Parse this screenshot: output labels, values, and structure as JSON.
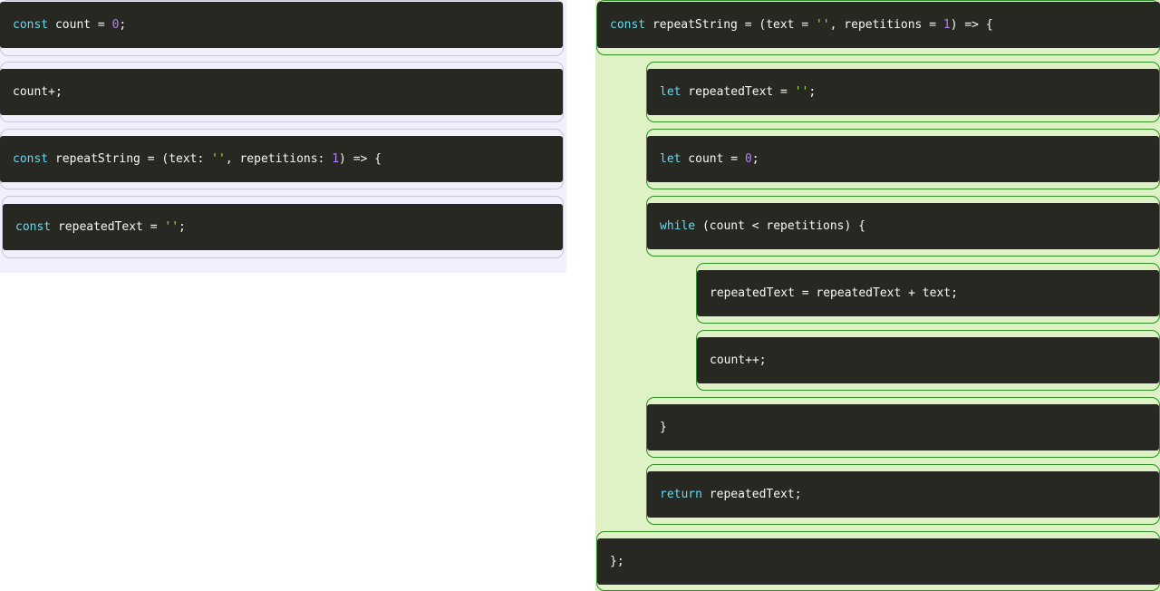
{
  "colors": {
    "keyword": "#66d9ef",
    "string": "#a6e22e",
    "number": "#ae81ff",
    "text": "#f8f8f2",
    "block_bg": "#272822",
    "left_pane_bg": "#f1f0fd",
    "right_pane_bg": "#dff2c6",
    "right_slot_border": "#2f8f24"
  },
  "source_blocks": [
    {
      "name": "source-block-const-count",
      "tokens": [
        {
          "t": "const",
          "k": "kw"
        },
        {
          "t": " count = ",
          "k": "txt"
        },
        {
          "t": "0",
          "k": "num"
        },
        {
          "t": ";",
          "k": "txt"
        }
      ]
    },
    {
      "name": "source-block-count-plus",
      "tokens": [
        {
          "t": "count+;",
          "k": "txt"
        }
      ]
    },
    {
      "name": "source-block-repeatstring-colon",
      "tokens": [
        {
          "t": "const",
          "k": "kw"
        },
        {
          "t": " repeatString = (text: ",
          "k": "txt"
        },
        {
          "t": "''",
          "k": "str"
        },
        {
          "t": ", repetitions: ",
          "k": "txt"
        },
        {
          "t": "1",
          "k": "num"
        },
        {
          "t": ") => {",
          "k": "txt"
        }
      ]
    },
    {
      "name": "source-block-const-repeatedtext",
      "tokens": [
        {
          "t": "const",
          "k": "kw"
        },
        {
          "t": " repeatedText = ",
          "k": "txt"
        },
        {
          "t": "''",
          "k": "str"
        },
        {
          "t": ";",
          "k": "txt"
        }
      ]
    }
  ],
  "solution_blocks": [
    {
      "name": "solution-block-repeatstring",
      "tokens": [
        {
          "t": "const",
          "k": "kw"
        },
        {
          "t": " repeatString = (text = ",
          "k": "txt"
        },
        {
          "t": "''",
          "k": "str"
        },
        {
          "t": ", repetitions = ",
          "k": "txt"
        },
        {
          "t": "1",
          "k": "num"
        },
        {
          "t": ") => {",
          "k": "txt"
        }
      ]
    },
    {
      "name": "solution-block-let-repeatedtext",
      "tokens": [
        {
          "t": "let",
          "k": "kw"
        },
        {
          "t": " repeatedText = ",
          "k": "txt"
        },
        {
          "t": "''",
          "k": "str"
        },
        {
          "t": ";",
          "k": "txt"
        }
      ]
    },
    {
      "name": "solution-block-let-count",
      "tokens": [
        {
          "t": "let",
          "k": "kw"
        },
        {
          "t": " count = ",
          "k": "txt"
        },
        {
          "t": "0",
          "k": "num"
        },
        {
          "t": ";",
          "k": "txt"
        }
      ]
    },
    {
      "name": "solution-block-while",
      "tokens": [
        {
          "t": "while",
          "k": "kw"
        },
        {
          "t": " (count < repetitions) {",
          "k": "txt"
        }
      ]
    },
    {
      "name": "solution-block-append-text",
      "tokens": [
        {
          "t": "repeatedText = repeatedText + text;",
          "k": "txt"
        }
      ]
    },
    {
      "name": "solution-block-count-increment",
      "tokens": [
        {
          "t": "count++;",
          "k": "txt"
        }
      ]
    },
    {
      "name": "solution-block-close-while",
      "tokens": [
        {
          "t": "}",
          "k": "txt"
        }
      ]
    },
    {
      "name": "solution-block-return",
      "tokens": [
        {
          "t": "return",
          "k": "kw"
        },
        {
          "t": " repeatedText;",
          "k": "txt"
        }
      ]
    },
    {
      "name": "solution-block-close-function",
      "tokens": [
        {
          "t": "};",
          "k": "txt"
        }
      ]
    }
  ]
}
